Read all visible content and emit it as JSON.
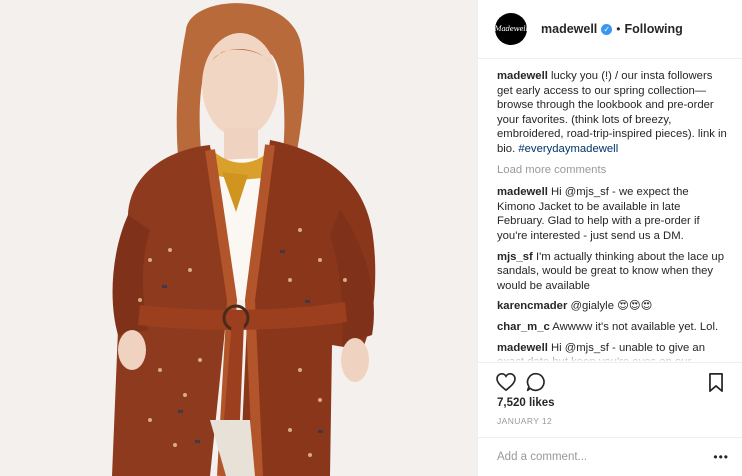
{
  "header": {
    "avatar_text": "Madewell",
    "username": "madewell",
    "verified_mark": "✓",
    "separator": "•",
    "follow_status": "Following"
  },
  "caption": {
    "username": "madewell",
    "text": "lucky you (!) / our insta followers get early access to our spring collection—browse through the lookbook and pre-order your favorites. (think lots of breezy, embroidered, road-trip-inspired pieces). link in bio. ",
    "hashtag": "#everydaymadewell"
  },
  "load_more": "Load more comments",
  "comments": [
    {
      "username": "madewell",
      "mention": "",
      "text": "Hi @mjs_sf - we expect the Kimono Jacket to be available in late February. Glad to help with a pre-order if you're interested - just send us a DM."
    },
    {
      "username": "mjs_sf",
      "mention": "",
      "text": "I'm actually thinking about the lace up sandals, would be great to know when they would be available"
    },
    {
      "username": "karencmader",
      "mention": "@gialyle",
      "text": " 😍😍😍"
    },
    {
      "username": "char_m_c",
      "mention": "",
      "text": "Awwww it's not available yet. Lol."
    },
    {
      "username": "madewell",
      "mention": "",
      "text": "Hi @mjs_sf - unable to give an exact date but keep you're eyes on our"
    }
  ],
  "actions": {
    "like_icon": "heart-icon",
    "comment_icon": "speech-bubble-icon",
    "save_icon": "bookmark-icon"
  },
  "likes": "7,520 likes",
  "date": "JANUARY 12",
  "add_comment": {
    "placeholder": "Add a comment...",
    "more_label": "•••"
  },
  "colors": {
    "link": "#003569",
    "muted": "#999999",
    "verified": "#3897f0",
    "jacket": "#8e3a1e",
    "scarf": "#d9a12b"
  }
}
